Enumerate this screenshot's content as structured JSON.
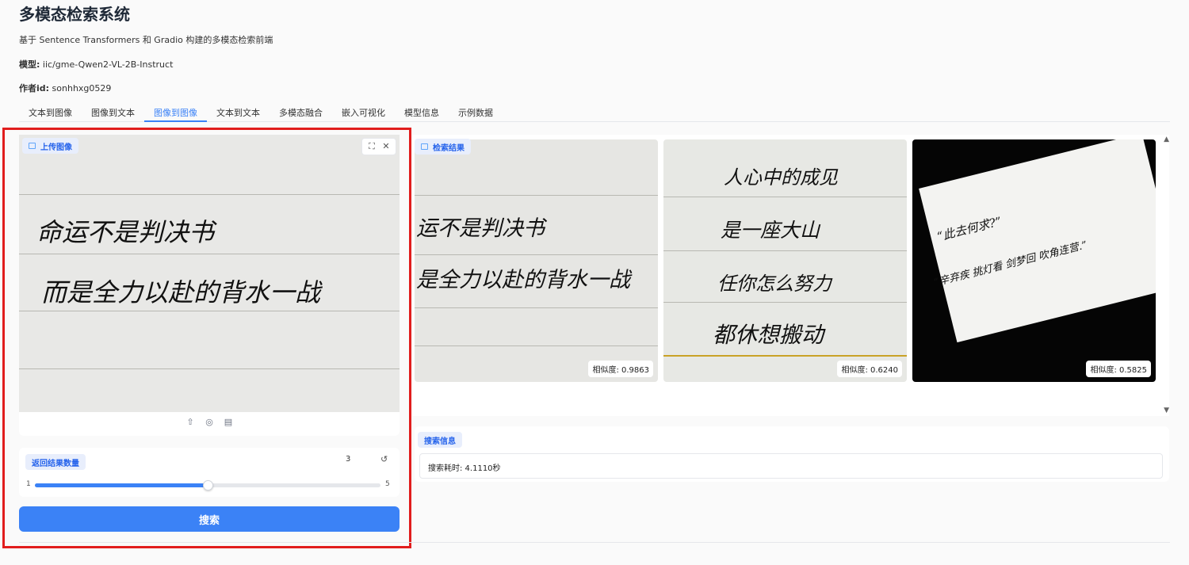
{
  "app": {
    "title": "多模态检索系统",
    "subtitle": "基于 Sentence Transformers 和 Gradio 构建的多模态检索前端",
    "model_label": "模型:",
    "model_value": " iic/gme-Qwen2-VL-2B-Instruct",
    "author_label": "作者id:",
    "author_value": " sonhhxg0529"
  },
  "tabs": [
    {
      "label": "文本到图像",
      "active": false
    },
    {
      "label": "图像到文本",
      "active": false
    },
    {
      "label": "图像到图像",
      "active": true
    },
    {
      "label": "文本到文本",
      "active": false
    },
    {
      "label": "多模态融合",
      "active": false
    },
    {
      "label": "嵌入可视化",
      "active": false
    },
    {
      "label": "模型信息",
      "active": false
    },
    {
      "label": "示例数据",
      "active": false
    }
  ],
  "upload": {
    "label": "上传图像",
    "icon": "image-icon",
    "controls": [
      "fullscreen-icon",
      "close-icon"
    ],
    "toolbar_icons": [
      "upload-icon",
      "webcam-icon",
      "clipboard-icon"
    ],
    "handwriting": [
      "命运不是判决书",
      "而是全力以赴的背水一战"
    ]
  },
  "slider": {
    "label": "返回结果数量",
    "value": "3",
    "min": "1",
    "max": "5",
    "fraction": 0.5,
    "reset_icon": "↺"
  },
  "search_button": "搜索",
  "results": {
    "label": "检索结果",
    "items": [
      {
        "lines": [
          "运不是判决书",
          "是全力以赴的背水一战"
        ],
        "score": "相似度: 0.9863"
      },
      {
        "lines": [
          "人心中的成见",
          "是一座大山",
          "任你怎么努力",
          "都休想搬动"
        ],
        "score": "相似度: 0.6240"
      },
      {
        "lines": [
          "“此去何求?”",
          "“辛弃疾 挑灯看 剑梦回 吹角连营.”"
        ],
        "score": "相似度: 0.5825"
      }
    ]
  },
  "info": {
    "label": "搜索信息",
    "text": "搜索耗时: 4.1110秒"
  },
  "colors": {
    "accent": "#3b82f6",
    "highlight_frame": "#e11d1d"
  }
}
